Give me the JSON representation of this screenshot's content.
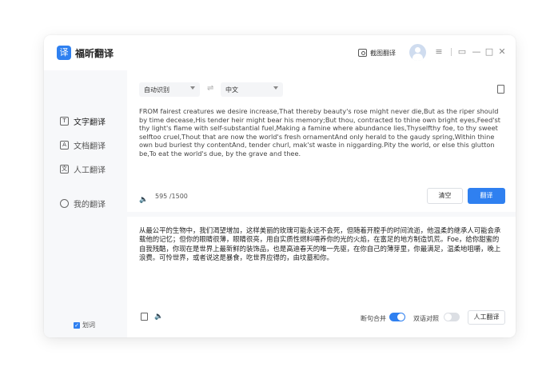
{
  "app": {
    "logo_glyph": "译",
    "title": "福昕翻译"
  },
  "titlebar": {
    "screenshot_label": "截图翻译",
    "menu_icon": "≡",
    "mini_icon": "▭",
    "minimize_icon": "—",
    "maximize_icon": "□",
    "close_icon": "✕"
  },
  "sidebar": {
    "items": [
      {
        "label": "文字翻译",
        "icon": "T",
        "active": true
      },
      {
        "label": "文档翻译",
        "icon": "A",
        "active": false
      },
      {
        "label": "人工翻译",
        "icon": "文",
        "active": false
      },
      {
        "label": "我的翻译",
        "icon": "",
        "active": false
      }
    ],
    "hotword_label": "划词",
    "hotword_checked": true
  },
  "source": {
    "from_lang": "自动识别",
    "to_lang": "中文",
    "swap_icon": "⇌",
    "text": "FROM fairest creatures we desire increase,That thereby beauty's rose might never die,But as the riper should by time decease,His tender heir might bear his memory;But thou, contracted to thine own bright eyes,Feed'st thy light's flame with self-substantial fuel,Making a famine where abundance lies,Thyselfthy foe, to thy sweet selftoo cruel,Thout that are now the world's fresh ornamentAnd only herald to the gaudy spring,Within thine own bud buriest thy contentAnd, tender churl, mak'st waste in niggarding.Pity the world, or else this glutton be,To eat the world's due, by the grave and thee.",
    "char_count": "595 /1500",
    "clear_label": "清空",
    "translate_label": "翻译"
  },
  "target": {
    "text": "从最公平的生物中，我们渴望增加，这样美丽的玫瑰可能永远不会死，但随着开膛手的时间流逝，他温柔的继承人可能会承载他的记忆；但你的眼睛很薄，眼睛很亮，用自实质性燃料喂养你的光的火焰，在富足的地方制造饥荒。Foe，给你甜蜜的自我残酷，你现在是世界上最新鲜的装饰品，也是高迪春天的唯一先驱，在你自己的薄芽里，你最满足，温柔地咀嚼，晚上浪费。可怜世界，或者说这是暴食，吃世界应得的，由坟墓和你。",
    "merge_label": "断句合并",
    "merge_on": true,
    "compare_label": "双语对照",
    "compare_on": false,
    "human_label": "人工翻译"
  },
  "colors": {
    "accent": "#2f80f0"
  }
}
